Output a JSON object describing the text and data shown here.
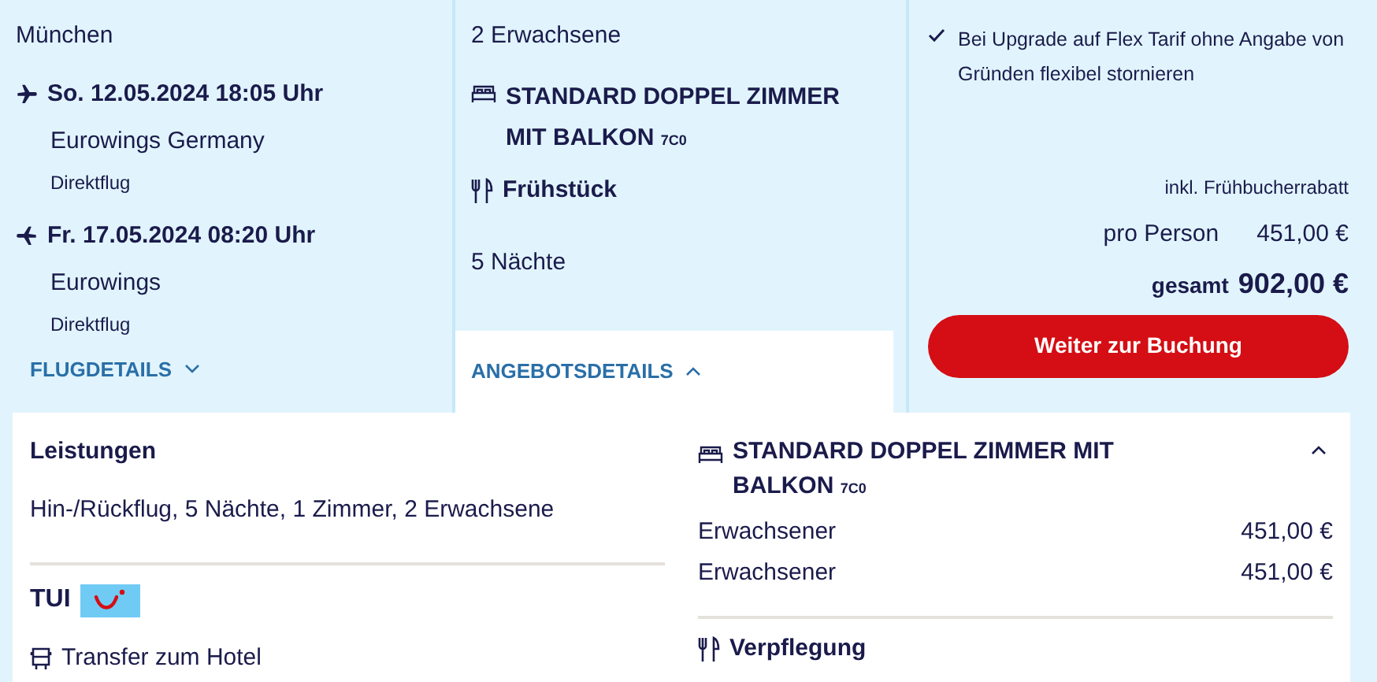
{
  "flights": {
    "origin": "München",
    "legs": [
      {
        "kind": "outbound",
        "date": "So. 12.05.2024 18:05 Uhr",
        "airline": "Eurowings Germany",
        "type": "Direktflug"
      },
      {
        "kind": "return",
        "date": "Fr. 17.05.2024 08:20 Uhr",
        "airline": "Eurowings",
        "type": "Direktflug"
      }
    ],
    "details_link": {
      "label": "FLUGDETAILS",
      "expanded": false
    }
  },
  "offer": {
    "travellers": "2 Erwachsene",
    "room": "STANDARD DOPPEL ZIMMER MIT BALKON",
    "room_code": "7C0",
    "board": "Frühstück",
    "nights": "5 Nächte",
    "details_link": {
      "label": "ANGEBOTSDETAILS",
      "expanded": true
    }
  },
  "price": {
    "benefit": "Bei Upgrade auf Flex Tarif ohne Angabe von Gründen flexibel stornieren",
    "discount_note": "inkl. Frühbucherrabatt",
    "per_person_label": "pro Person",
    "per_person": "451,00 €",
    "total_label": "gesamt",
    "total": "902,00 €",
    "button": "Weiter zur Buchung"
  },
  "details": {
    "services_title": "Leistungen",
    "services": "Hin-/Rückflug, 5 Nächte, 1 Zimmer, 2 Erwachsene",
    "provider": "TUI",
    "transfer": "Transfer zum Hotel",
    "room": {
      "title": "STANDARD DOPPEL ZIMMER MIT BALKON",
      "code": "7C0",
      "expanded": true,
      "lines": [
        {
          "label": "Erwachsener",
          "price": "451,00 €"
        },
        {
          "label": "Erwachsener",
          "price": "451,00 €"
        }
      ]
    },
    "board_title": "Verpflegung"
  }
}
